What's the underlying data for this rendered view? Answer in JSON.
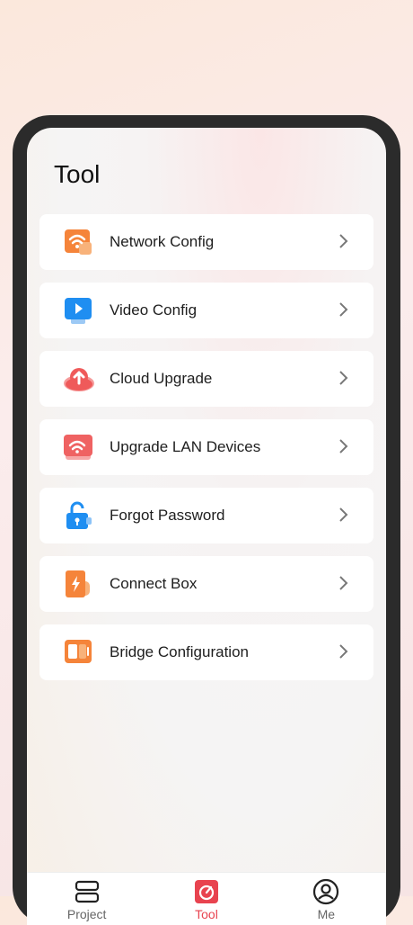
{
  "page": {
    "title": "Tool"
  },
  "menu": {
    "items": [
      {
        "label": "Network Config",
        "icon": "wifi-icon"
      },
      {
        "label": "Video Config",
        "icon": "video-play-icon"
      },
      {
        "label": "Cloud Upgrade",
        "icon": "cloud-upload-icon"
      },
      {
        "label": "Upgrade LAN Devices",
        "icon": "lan-wifi-icon"
      },
      {
        "label": "Forgot Password",
        "icon": "lock-icon"
      },
      {
        "label": "Connect Box",
        "icon": "battery-bolt-icon"
      },
      {
        "label": "Bridge Configuration",
        "icon": "bridge-icon"
      }
    ]
  },
  "tabbar": {
    "tabs": [
      {
        "label": "Project",
        "icon": "project-icon",
        "active": false
      },
      {
        "label": "Tool",
        "icon": "tool-icon",
        "active": true
      },
      {
        "label": "Me",
        "icon": "profile-icon",
        "active": false
      }
    ]
  },
  "colors": {
    "accent": "#e8434f",
    "orange": "#f5843a",
    "blue": "#1f8ef1",
    "red": "#ef5a5a"
  }
}
